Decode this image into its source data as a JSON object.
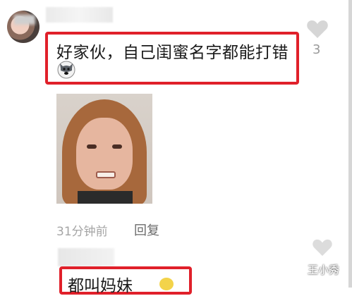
{
  "comment1": {
    "text": "好家伙，自己闺蜜名字都能打错",
    "emoji": "dog-emoji-icon",
    "like_count": "3",
    "time": "31分钟前",
    "reply_label": "回复"
  },
  "comment2": {
    "text": "都叫妈妹"
  },
  "watermark": "王小秀",
  "colors": {
    "highlight_border": "#e0202a",
    "muted_text": "#a5a5a5"
  }
}
